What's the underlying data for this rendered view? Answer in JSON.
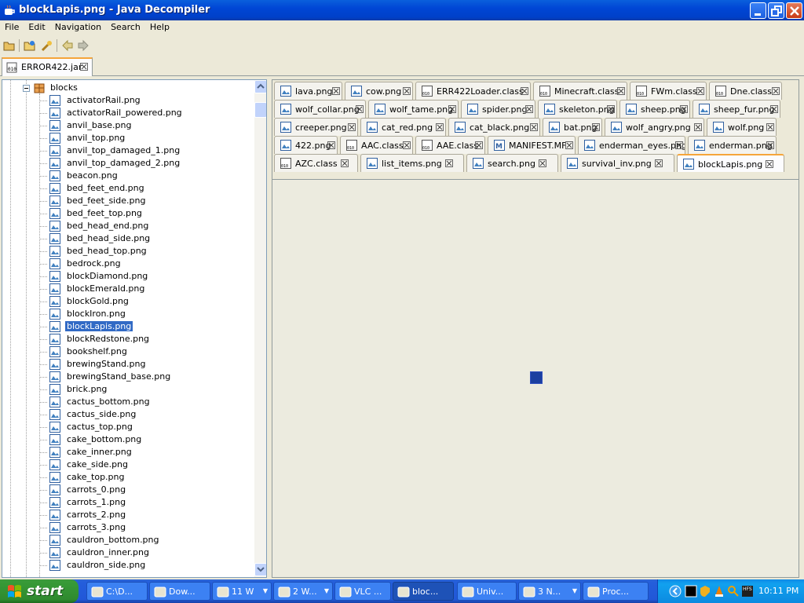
{
  "window": {
    "title": "blockLapis.png - Java Decompiler"
  },
  "menu": [
    "File",
    "Edit",
    "Navigation",
    "Search",
    "Help"
  ],
  "file_tab": {
    "label": "ERROR422.jar"
  },
  "tree": {
    "folder": "blocks",
    "items": [
      "activatorRail.png",
      "activatorRail_powered.png",
      "anvil_base.png",
      "anvil_top.png",
      "anvil_top_damaged_1.png",
      "anvil_top_damaged_2.png",
      "beacon.png",
      "bed_feet_end.png",
      "bed_feet_side.png",
      "bed_feet_top.png",
      "bed_head_end.png",
      "bed_head_side.png",
      "bed_head_top.png",
      "bedrock.png",
      "blockDiamond.png",
      "blockEmerald.png",
      "blockGold.png",
      "blockIron.png",
      "blockLapis.png",
      "blockRedstone.png",
      "bookshelf.png",
      "brewingStand.png",
      "brewingStand_base.png",
      "brick.png",
      "cactus_bottom.png",
      "cactus_side.png",
      "cactus_top.png",
      "cake_bottom.png",
      "cake_inner.png",
      "cake_side.png",
      "cake_top.png",
      "carrots_0.png",
      "carrots_1.png",
      "carrots_2.png",
      "carrots_3.png",
      "cauldron_bottom.png",
      "cauldron_inner.png",
      "cauldron_side.png"
    ],
    "selected": "blockLapis.png"
  },
  "editor_tabs": [
    [
      "lava.png",
      "cow.png",
      "ERR422Loader.class",
      "Minecraft.class",
      "FWm.class",
      "Dne.class"
    ],
    [
      "wolf_collar.png",
      "wolf_tame.png",
      "spider.png",
      "skeleton.png",
      "sheep.png",
      "sheep_fur.png"
    ],
    [
      "creeper.png",
      "cat_red.png",
      "cat_black.png",
      "bat.png",
      "wolf_angry.png",
      "wolf.png"
    ],
    [
      "422.png",
      "AAC.class",
      "AAE.class",
      "MANIFEST.MF",
      "enderman_eyes.png",
      "enderman.png"
    ],
    [
      "AZC.class",
      "list_items.png",
      "search.png",
      "survival_inv.png",
      "blockLapis.png"
    ]
  ],
  "active_tab": "blockLapis.png",
  "image_color": "#1b3fa0",
  "taskbar": {
    "start": "start",
    "tasks": [
      "C:\\D...",
      "Dow...",
      "11 W",
      "2 W...",
      "VLC ...",
      "bloc...",
      "Univ...",
      "3 N...",
      "Proc..."
    ],
    "clock": "10:11 PM"
  }
}
